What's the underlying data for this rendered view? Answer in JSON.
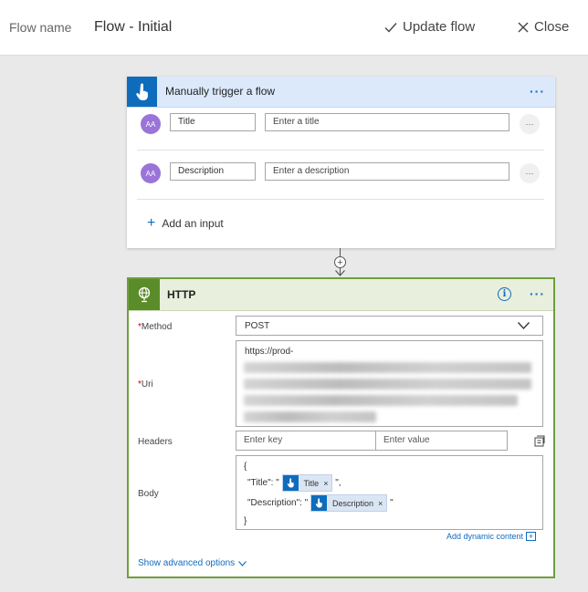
{
  "header": {
    "flow_name_label": "Flow name",
    "flow_name_value": "Flow - Initial",
    "update_label": "Update flow",
    "close_label": "Close"
  },
  "trigger": {
    "title": "Manually trigger a flow",
    "more": "···",
    "inputs": [
      {
        "avatar": "AA",
        "name": "Title",
        "placeholder": "Enter a title",
        "more": "···"
      },
      {
        "avatar": "AA",
        "name": "Description",
        "placeholder": "Enter a description",
        "more": "···"
      }
    ],
    "add_input": "Add an input"
  },
  "http": {
    "title": "HTTP",
    "info": "i",
    "more": "···",
    "method_label": "Method",
    "method_value": "POST",
    "uri_label": "Uri",
    "uri_value": "https://prod-",
    "headers_label": "Headers",
    "header_key_placeholder": "Enter key",
    "header_value_placeholder": "Enter value",
    "body_label": "Body",
    "body": {
      "open": "{",
      "title_key": "\"Title\": \"",
      "title_token": "Title",
      "title_end": "\",",
      "desc_key": "\"Description\": \"",
      "desc_token": "Description",
      "desc_end": "\"",
      "close": "}",
      "token_remove": "×"
    },
    "add_dynamic": "Add dynamic content",
    "add_dynamic_icon": "+",
    "show_advanced": "Show advanced options",
    "required_mark": "*"
  },
  "colors": {
    "accent": "#0f6cbd",
    "http_green": "#6d9f3c",
    "avatar_purple": "#9a74d8"
  }
}
